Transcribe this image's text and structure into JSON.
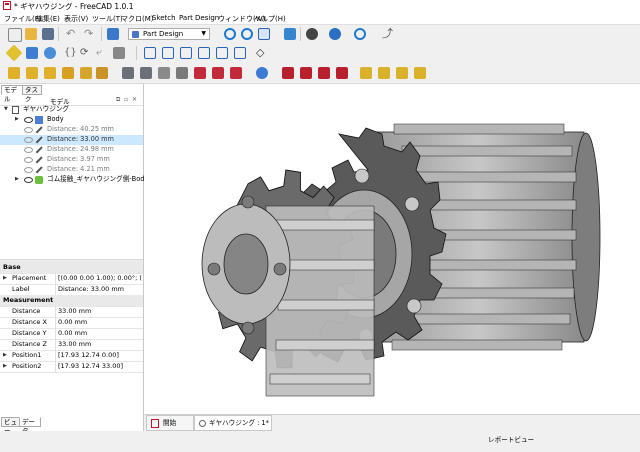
{
  "window": {
    "title": "* ギヤハウジング - FreeCAD 1.0.1"
  },
  "menu": [
    "ファイル(F)",
    "編集(E)",
    "表示(V)",
    "ツール(T)",
    "マクロ(M)",
    "Sketch",
    "Part Design",
    "ウィンドウ(W)",
    "ヘルプ(H)"
  ],
  "workbench": {
    "selected": "Part Design"
  },
  "left_panel": {
    "tabs": [
      "モデル",
      "タスク"
    ],
    "header": "モデル",
    "tree": [
      {
        "label": "ギヤハウジング",
        "state": "root"
      },
      {
        "label": "Body",
        "state": "normal"
      },
      {
        "label": "Distance: 40.25 mm",
        "state": "dim"
      },
      {
        "label": "Distance: 33.00 mm",
        "state": "selected"
      },
      {
        "label": "Distance: 24.98 mm",
        "state": "dim"
      },
      {
        "label": "Distance: 3.97 mm",
        "state": "dim"
      },
      {
        "label": "Distance: 4.21 mm",
        "state": "dim"
      },
      {
        "label": "ゴム接触_ギヤハウジング側-Body",
        "state": "normal"
      }
    ],
    "property_groups": [
      {
        "name": "Base",
        "rows": [
          {
            "key": "Placement",
            "value": "[(0.00 0.00 1.00); 0.00°; (0.00 ..."
          },
          {
            "key": "Label",
            "value": "Distance: 33.00 mm"
          }
        ]
      },
      {
        "name": "Measurement",
        "rows": [
          {
            "key": "Distance",
            "value": "33.00 mm"
          },
          {
            "key": "Distance X",
            "value": "0.00 mm"
          },
          {
            "key": "Distance Y",
            "value": "0.00 mm"
          },
          {
            "key": "Distance Z",
            "value": "33.00 mm"
          },
          {
            "key": "Position1",
            "value": "[17.93 12.74 0.00]"
          },
          {
            "key": "Position2",
            "value": "[17.93 12.74 33.00]"
          }
        ]
      }
    ],
    "bottom_tabs": [
      "ビュー",
      "データ"
    ]
  },
  "doc_tabs": [
    {
      "label": "開始",
      "active": false
    },
    {
      "label": "ギヤハウジング : 1*",
      "active": true
    }
  ],
  "status": {
    "report_view": "レポートビュー"
  },
  "colors": {
    "selection": "#cce8ff",
    "gear": "#8c8c8c",
    "accent": "#c0132b"
  }
}
